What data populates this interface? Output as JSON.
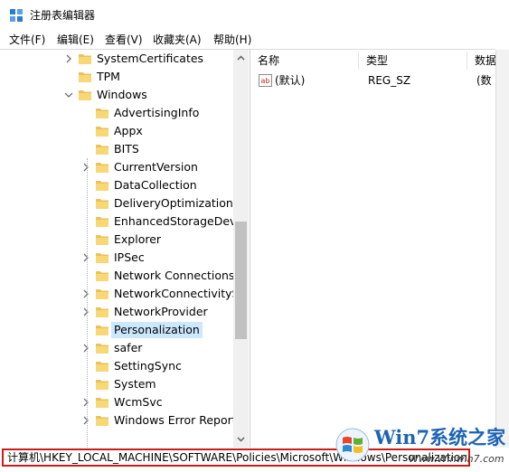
{
  "window": {
    "title": "注册表编辑器"
  },
  "menu": [
    "文件(F)",
    "编辑(E)",
    "查看(V)",
    "收藏夹(A)",
    "帮助(H)"
  ],
  "tree": [
    {
      "label": "SystemCertificates",
      "expander": "collapsed"
    },
    {
      "label": "TPM",
      "expander": "none"
    },
    {
      "label": "Windows",
      "expander": "expanded"
    },
    {
      "label": "AdvertisingInfo",
      "expander": "none"
    },
    {
      "label": "Appx",
      "expander": "none"
    },
    {
      "label": "BITS",
      "expander": "none"
    },
    {
      "label": "CurrentVersion",
      "expander": "collapsed"
    },
    {
      "label": "DataCollection",
      "expander": "none"
    },
    {
      "label": "DeliveryOptimization",
      "expander": "none"
    },
    {
      "label": "EnhancedStorageDevic",
      "expander": "none"
    },
    {
      "label": "Explorer",
      "expander": "none"
    },
    {
      "label": "IPSec",
      "expander": "collapsed"
    },
    {
      "label": "Network Connections",
      "expander": "none"
    },
    {
      "label": "NetworkConnectivitySt",
      "expander": "collapsed"
    },
    {
      "label": "NetworkProvider",
      "expander": "collapsed"
    },
    {
      "label": "Personalization",
      "expander": "none",
      "selected": true
    },
    {
      "label": "safer",
      "expander": "collapsed"
    },
    {
      "label": "SettingSync",
      "expander": "none"
    },
    {
      "label": "System",
      "expander": "none"
    },
    {
      "label": "WcmSvc",
      "expander": "collapsed"
    },
    {
      "label": "Windows Error Report",
      "expander": "collapsed"
    }
  ],
  "list": {
    "columns": [
      "名称",
      "类型",
      "数据"
    ],
    "rows": [
      {
        "name": "(默认)",
        "type": "REG_SZ",
        "data": "(数"
      }
    ]
  },
  "statusbar": {
    "path": "计算机\\HKEY_LOCAL_MACHINE\\SOFTWARE\\Policies\\Microsoft\\Windows\\Personalization"
  },
  "watermark": {
    "title": "Win7系统之家",
    "url": "Www.Winwin7.com"
  },
  "colors": {
    "selection": "#cce8ff",
    "folder": "#f8d775",
    "status_border": "#d01a1a",
    "scroll_thumb": "#c1c1c1"
  },
  "icons": {
    "app": "regedit-icon",
    "folder": "folder-icon",
    "value": "string-value-icon"
  }
}
